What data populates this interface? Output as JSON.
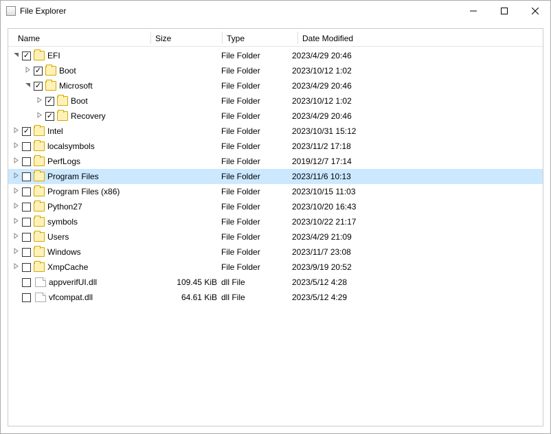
{
  "window": {
    "title": "File Explorer"
  },
  "columns": {
    "name": "Name",
    "size": "Size",
    "type": "Type",
    "date": "Date Modified"
  },
  "rows": [
    {
      "indent": 0,
      "expander": "open",
      "checked": true,
      "kind": "folder",
      "name": "EFI",
      "size": "",
      "type": "File Folder",
      "date": "2023/4/29 20:46",
      "selected": false
    },
    {
      "indent": 1,
      "expander": "closed",
      "checked": true,
      "kind": "folder",
      "name": "Boot",
      "size": "",
      "type": "File Folder",
      "date": "2023/10/12 1:02",
      "selected": false
    },
    {
      "indent": 1,
      "expander": "open",
      "checked": true,
      "kind": "folder",
      "name": "Microsoft",
      "size": "",
      "type": "File Folder",
      "date": "2023/4/29 20:46",
      "selected": false
    },
    {
      "indent": 2,
      "expander": "closed",
      "checked": true,
      "kind": "folder",
      "name": "Boot",
      "size": "",
      "type": "File Folder",
      "date": "2023/10/12 1:02",
      "selected": false
    },
    {
      "indent": 2,
      "expander": "closed",
      "checked": true,
      "kind": "folder",
      "name": "Recovery",
      "size": "",
      "type": "File Folder",
      "date": "2023/4/29 20:46",
      "selected": false
    },
    {
      "indent": 0,
      "expander": "closed",
      "checked": true,
      "kind": "folder",
      "name": "Intel",
      "size": "",
      "type": "File Folder",
      "date": "2023/10/31 15:12",
      "selected": false
    },
    {
      "indent": 0,
      "expander": "closed",
      "checked": false,
      "kind": "folder",
      "name": "localsymbols",
      "size": "",
      "type": "File Folder",
      "date": "2023/11/2 17:18",
      "selected": false
    },
    {
      "indent": 0,
      "expander": "closed",
      "checked": false,
      "kind": "folder",
      "name": "PerfLogs",
      "size": "",
      "type": "File Folder",
      "date": "2019/12/7 17:14",
      "selected": false
    },
    {
      "indent": 0,
      "expander": "closed",
      "checked": false,
      "kind": "folder",
      "name": "Program Files",
      "size": "",
      "type": "File Folder",
      "date": "2023/11/6 10:13",
      "selected": true
    },
    {
      "indent": 0,
      "expander": "closed",
      "checked": false,
      "kind": "folder",
      "name": "Program Files (x86)",
      "size": "",
      "type": "File Folder",
      "date": "2023/10/15 11:03",
      "selected": false
    },
    {
      "indent": 0,
      "expander": "closed",
      "checked": false,
      "kind": "folder",
      "name": "Python27",
      "size": "",
      "type": "File Folder",
      "date": "2023/10/20 16:43",
      "selected": false
    },
    {
      "indent": 0,
      "expander": "closed",
      "checked": false,
      "kind": "folder",
      "name": "symbols",
      "size": "",
      "type": "File Folder",
      "date": "2023/10/22 21:17",
      "selected": false
    },
    {
      "indent": 0,
      "expander": "closed",
      "checked": false,
      "kind": "folder",
      "name": "Users",
      "size": "",
      "type": "File Folder",
      "date": "2023/4/29 21:09",
      "selected": false
    },
    {
      "indent": 0,
      "expander": "closed",
      "checked": false,
      "kind": "folder",
      "name": "Windows",
      "size": "",
      "type": "File Folder",
      "date": "2023/11/7 23:08",
      "selected": false
    },
    {
      "indent": 0,
      "expander": "closed",
      "checked": false,
      "kind": "folder",
      "name": "XmpCache",
      "size": "",
      "type": "File Folder",
      "date": "2023/9/19 20:52",
      "selected": false
    },
    {
      "indent": 0,
      "expander": "none",
      "checked": false,
      "kind": "file",
      "name": "appverifUI.dll",
      "size": "109.45 KiB",
      "type": "dll File",
      "date": "2023/5/12 4:28",
      "selected": false
    },
    {
      "indent": 0,
      "expander": "none",
      "checked": false,
      "kind": "file",
      "name": "vfcompat.dll",
      "size": "64.61 KiB",
      "type": "dll File",
      "date": "2023/5/12 4:29",
      "selected": false
    }
  ]
}
